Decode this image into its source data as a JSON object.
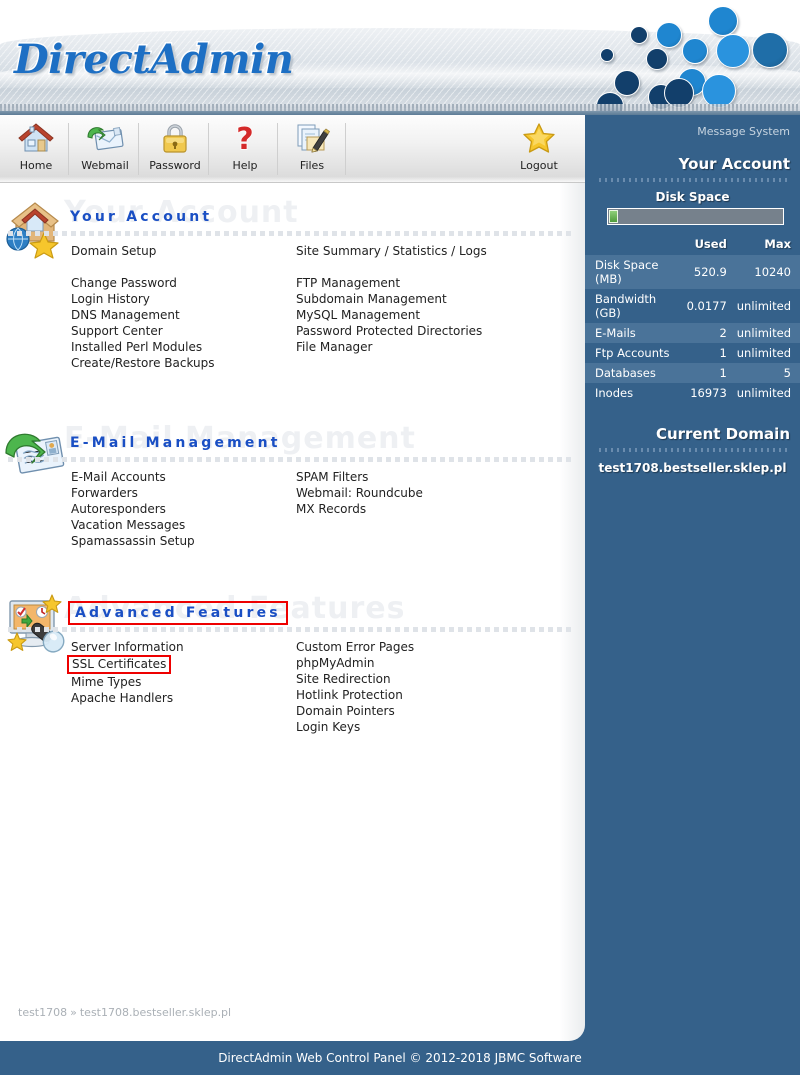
{
  "brand": {
    "logo_text": "DirectAdmin",
    "accent_blue": "#1d6fc4",
    "sidebar_blue": "#35618a",
    "highlight_red": "#ee0000"
  },
  "toolbar": {
    "items": [
      {
        "label": "Home",
        "icon": "home-icon"
      },
      {
        "label": "Webmail",
        "icon": "envelope-arrow-icon"
      },
      {
        "label": "Password",
        "icon": "padlock-icon"
      },
      {
        "label": "Help",
        "icon": "question-mark-icon"
      },
      {
        "label": "Files",
        "icon": "documents-pencil-icon"
      },
      {
        "label": "Logout",
        "icon": "star-icon"
      }
    ]
  },
  "sections": [
    {
      "title": "Your Account",
      "icon": "house-box-globe-star-icon",
      "highlighted": false,
      "left_links": [
        {
          "label": "Domain Setup",
          "gap_after": true
        },
        {
          "label": "Change Password"
        },
        {
          "label": "Login History"
        },
        {
          "label": "DNS Management"
        },
        {
          "label": "Support Center"
        },
        {
          "label": "Installed Perl Modules"
        },
        {
          "label": "Create/Restore Backups"
        }
      ],
      "right_links": [
        {
          "label": "Site Summary / Statistics / Logs",
          "gap_after": true
        },
        {
          "label": "FTP Management"
        },
        {
          "label": "Subdomain Management"
        },
        {
          "label": "MySQL Management"
        },
        {
          "label": "Password Protected Directories"
        },
        {
          "label": "File Manager"
        }
      ]
    },
    {
      "title": "E-Mail Management",
      "icon": "envelope-green-arrow-icon",
      "highlighted": false,
      "left_links": [
        {
          "label": "E-Mail Accounts"
        },
        {
          "label": "Forwarders"
        },
        {
          "label": "Autoresponders"
        },
        {
          "label": "Vacation Messages"
        },
        {
          "label": "Spamassassin Setup"
        }
      ],
      "right_links": [
        {
          "label": "SPAM Filters"
        },
        {
          "label": "Webmail: Roundcube"
        },
        {
          "label": "MX Records"
        }
      ]
    },
    {
      "title": "Advanced Features",
      "icon": "monitor-magnifier-stars-icon",
      "highlighted": true,
      "left_links": [
        {
          "label": "Server Information"
        },
        {
          "label": "SSL Certificates",
          "highlighted": true
        },
        {
          "label": "Mime Types"
        },
        {
          "label": "Apache Handlers"
        }
      ],
      "right_links": [
        {
          "label": "Custom Error Pages"
        },
        {
          "label": "phpMyAdmin"
        },
        {
          "label": "Site Redirection"
        },
        {
          "label": "Hotlink Protection"
        },
        {
          "label": "Domain Pointers"
        },
        {
          "label": "Login Keys"
        }
      ]
    }
  ],
  "breadcrumb": {
    "user": "test1708",
    "separator": "»",
    "domain": "test1708.bestseller.sklep.pl"
  },
  "sidebar": {
    "message_system_label": "Message System",
    "account_heading": "Your Account",
    "disk_space_label": "Disk Space",
    "disk_usage_percent": 5,
    "columns": {
      "name": "",
      "used": "Used",
      "max": "Max"
    },
    "rows": [
      {
        "name": "Disk Space (MB)",
        "used": "520.9",
        "max": "10240"
      },
      {
        "name": "Bandwidth (GB)",
        "used": "0.0177",
        "max": "unlimited"
      },
      {
        "name": "E-Mails",
        "used": "2",
        "max": "unlimited"
      },
      {
        "name": "Ftp Accounts",
        "used": "1",
        "max": "unlimited"
      },
      {
        "name": "Databases",
        "used": "1",
        "max": "5"
      },
      {
        "name": "Inodes",
        "used": "16973",
        "max": "unlimited"
      }
    ],
    "current_domain_heading": "Current Domain",
    "current_domain": "test1708.bestseller.sklep.pl"
  },
  "footer": {
    "text": "DirectAdmin Web Control Panel © 2012-2018 JBMC Software"
  }
}
